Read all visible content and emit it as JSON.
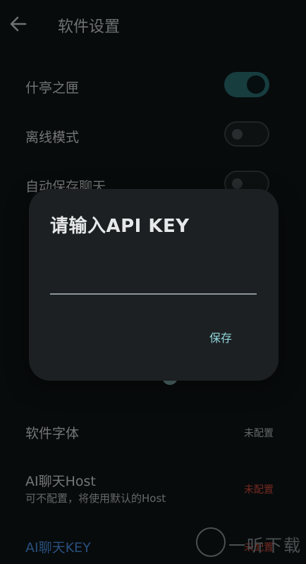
{
  "header": {
    "title": "软件设置",
    "back_icon": "arrow-left-icon"
  },
  "settings": {
    "toggle_shitingzhixia": {
      "label": "什亭之匣",
      "checked": true
    },
    "toggle_offline": {
      "label": "离线模式",
      "checked": false
    },
    "toggle_autosave": {
      "label": "自动保存聊天",
      "checked": false
    },
    "font": {
      "label": "软件字体",
      "value": "未配置"
    },
    "ai_host": {
      "label": "AI聊天Host",
      "sublabel": "可不配置，将使用默认的Host",
      "value": "未配置"
    },
    "ai_key": {
      "label": "AI聊天KEY",
      "value": "未配置"
    }
  },
  "dialog": {
    "title": "请输入API KEY",
    "input_value": "",
    "save_label": "保存"
  },
  "watermark": {
    "text": "一听下载"
  },
  "colors": {
    "background": "#101416",
    "accent": "#2a6f73",
    "accent_text": "#8fd3d8",
    "warn": "#d64d3e",
    "link": "#4a90e2",
    "dialog_bg": "#1c2022"
  }
}
